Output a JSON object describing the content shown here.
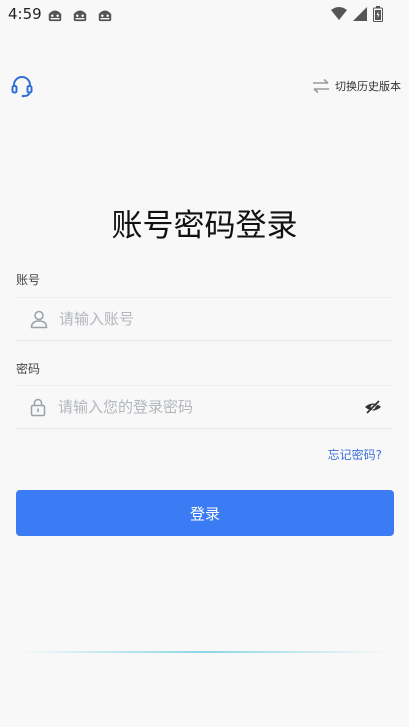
{
  "status_bar": {
    "time": "4:59",
    "icons": [
      "android-notification-icon",
      "android-notification-icon",
      "android-notification-icon",
      "wifi-icon",
      "signal-icon",
      "battery-icon"
    ]
  },
  "header": {
    "support_icon": "headset-icon",
    "switch_version_label": "切换历史版本",
    "switch_icon": "swap-arrows-icon"
  },
  "title": "账号密码登录",
  "form": {
    "account_label": "账号",
    "account_placeholder": "请输入账号",
    "password_label": "密码",
    "password_placeholder": "请输入您的登录密码",
    "forgot_label": "忘记密码?"
  },
  "login_button_label": "登录",
  "colors": {
    "accent": "#3b7cf5",
    "link": "#3b6fd8",
    "support_icon": "#2f6ed8"
  }
}
